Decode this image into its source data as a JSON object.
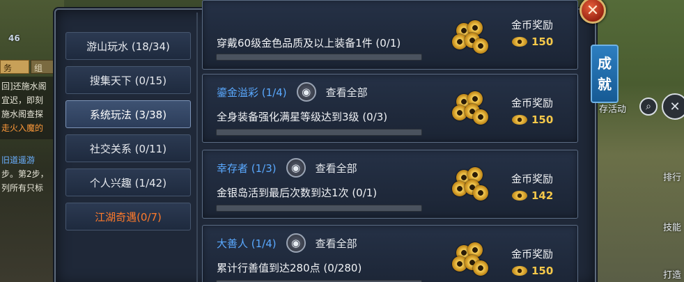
{
  "window": {
    "title": "成就",
    "side_tab": [
      "成",
      "就"
    ],
    "close_label": "✕"
  },
  "background": {
    "level": "46",
    "left_tabs": [
      "务",
      "组"
    ],
    "left_lines": [
      {
        "text": "回]还施水阁",
        "color": "#e8e6d8"
      },
      {
        "text": "宜迟，即刻",
        "color": "#e8e6d8"
      },
      {
        "text": "施水阁查探",
        "color": "#e8e6d8"
      },
      {
        "text": "走火入魔的",
        "color": "#ff9a3a"
      }
    ],
    "left_lines2": [
      {
        "text": "旧道遥游",
        "color": "#6ab0ff"
      },
      {
        "text": "步。第2步，",
        "color": "#e8e6d8"
      },
      {
        "text": "列所有只标",
        "color": "#e8e6d8"
      }
    ],
    "right_labels": {
      "activity": "存活动",
      "rank": "排行",
      "skill": "技能",
      "fight": "打造"
    }
  },
  "categories": [
    {
      "label": "游山玩水 (18/34)",
      "active": false,
      "highlight": false
    },
    {
      "label": "搜集天下 (0/15)",
      "active": false,
      "highlight": false
    },
    {
      "label": "系统玩法 (3/38)",
      "active": true,
      "highlight": false
    },
    {
      "label": "社交关系 (0/11)",
      "active": false,
      "highlight": false
    },
    {
      "label": "个人兴趣 (1/42)",
      "active": false,
      "highlight": false
    },
    {
      "label": "江湖奇遇(0/7)",
      "active": false,
      "highlight": true
    }
  ],
  "achievements": [
    {
      "name": "",
      "view_all": "",
      "desc": "穿戴60级金色品质及以上装备1件 (0/1)",
      "progress": 0,
      "reward_label": "金币奖励",
      "reward_amount": "150"
    },
    {
      "name": "鎏金溢彩 (1/4)",
      "view_all": "查看全部",
      "desc": "全身装备强化满星等级达到3级 (0/3)",
      "progress": 0,
      "reward_label": "金币奖励",
      "reward_amount": "150"
    },
    {
      "name": "幸存者 (1/3)",
      "view_all": "查看全部",
      "desc": "金银岛活到最后次数到达1次 (0/1)",
      "progress": 0,
      "reward_label": "金币奖励",
      "reward_amount": "142"
    },
    {
      "name": "大善人 (1/4)",
      "view_all": "查看全部",
      "desc": "累计行善值到达280点 (0/280)",
      "progress": 0,
      "reward_label": "金币奖励",
      "reward_amount": "150"
    }
  ],
  "icons": {
    "eye": "eye-icon",
    "coin": "gold-coin-icon",
    "close": "close-icon"
  }
}
